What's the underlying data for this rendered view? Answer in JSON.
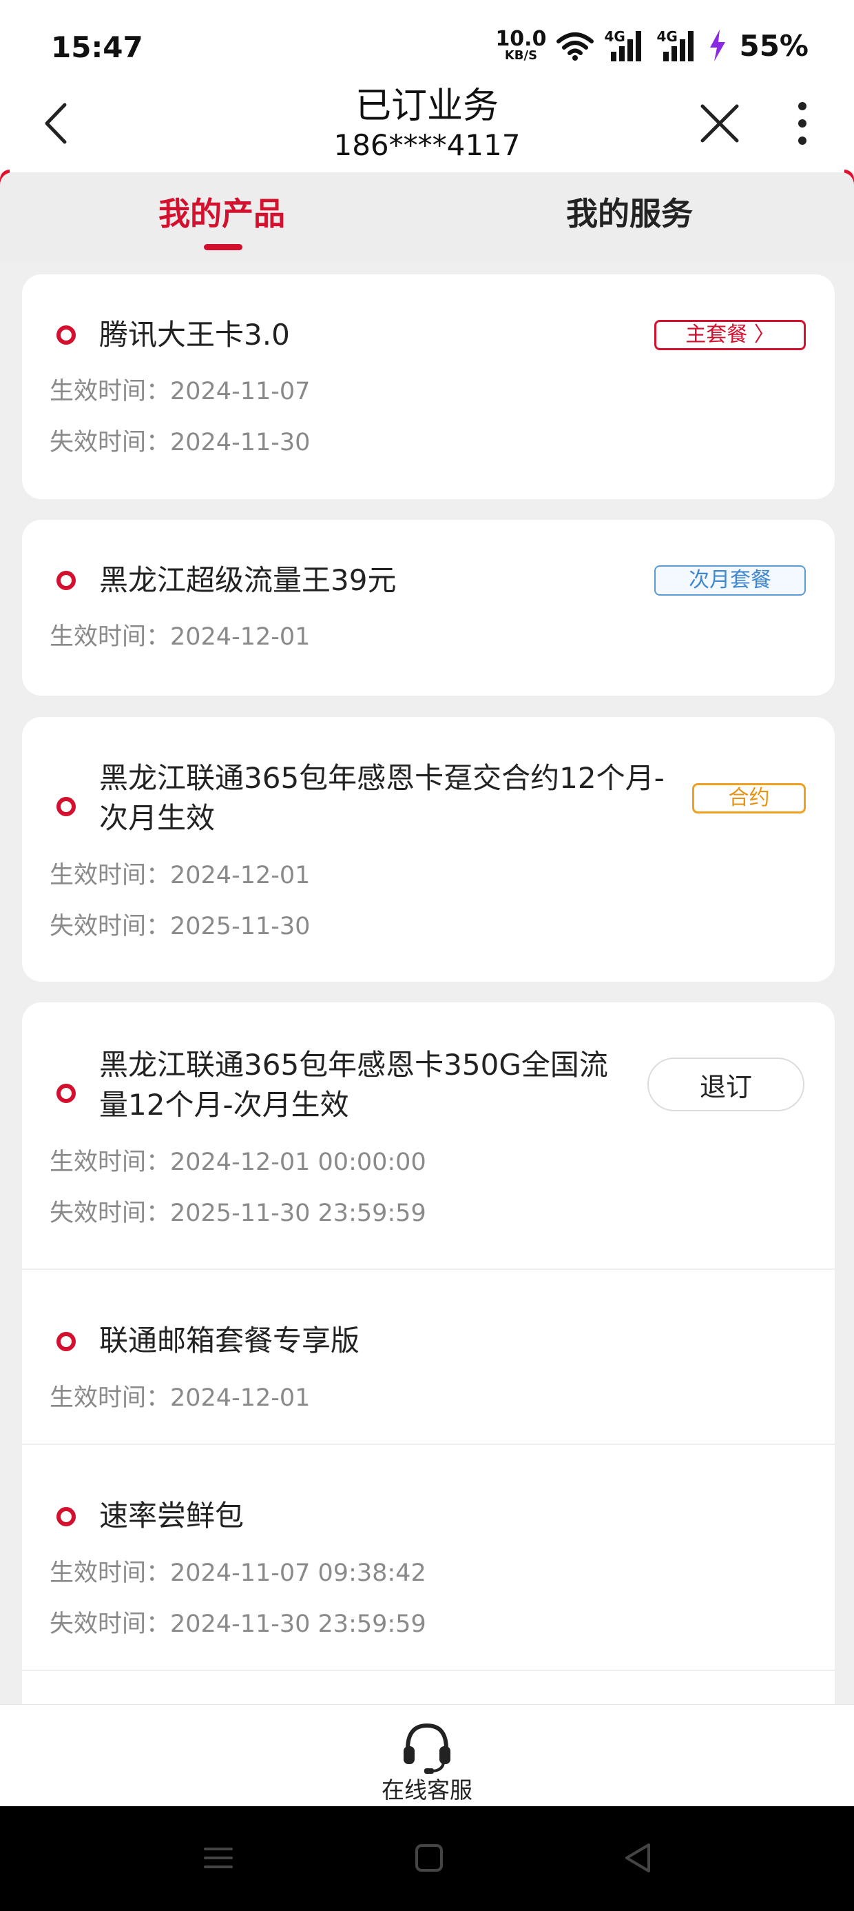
{
  "status_bar": {
    "time": "15:47",
    "net_speed_value": "10.0",
    "net_speed_unit": "KB/S",
    "sim1": "4G",
    "sim2": "4G",
    "battery": "55%"
  },
  "header": {
    "title": "已订业务",
    "phone": "186****4117"
  },
  "tabs": [
    {
      "label": "我的产品",
      "active": true
    },
    {
      "label": "我的服务",
      "active": false
    }
  ],
  "products": [
    {
      "name": "腾讯大王卡3.0",
      "tag": "主套餐 〉",
      "dates": [
        "生效时间：2024-11-07",
        "失效时间：2024-11-30"
      ]
    },
    {
      "name": "黑龙江超级流量王39元",
      "tag": "次月套餐",
      "dates": [
        "生效时间：2024-12-01"
      ]
    },
    {
      "name_line1": "黑龙江联通365包年感恩卡趸交合约12个月-",
      "name_line2": "次月生效",
      "tag": "合约",
      "dates": [
        "生效时间：2024-12-01",
        "失效时间：2025-11-30"
      ]
    },
    {
      "name_line1": "黑龙江联通365包年感恩卡350G全国流",
      "name_line2": "量12个月-次月生效",
      "button": "退订",
      "dates": [
        "生效时间：2024-12-01 00:00:00",
        "失效时间：2025-11-30 23:59:59"
      ]
    },
    {
      "name": "联通邮箱套餐专享版",
      "dates": [
        "生效时间：2024-12-01"
      ]
    },
    {
      "name": "速率尝鲜包",
      "dates": [
        "生效时间：2024-11-07 09:38:42",
        "失效时间：2024-11-30 23:59:59"
      ]
    }
  ],
  "bottom": {
    "customer_service_label": "在线客服",
    "icon": "headset-icon"
  },
  "colors": {
    "accent": "#d3112e",
    "next_month_tag": "#3f87cf",
    "contract_tag": "#e89410",
    "date_text": "#8a8a8a"
  }
}
